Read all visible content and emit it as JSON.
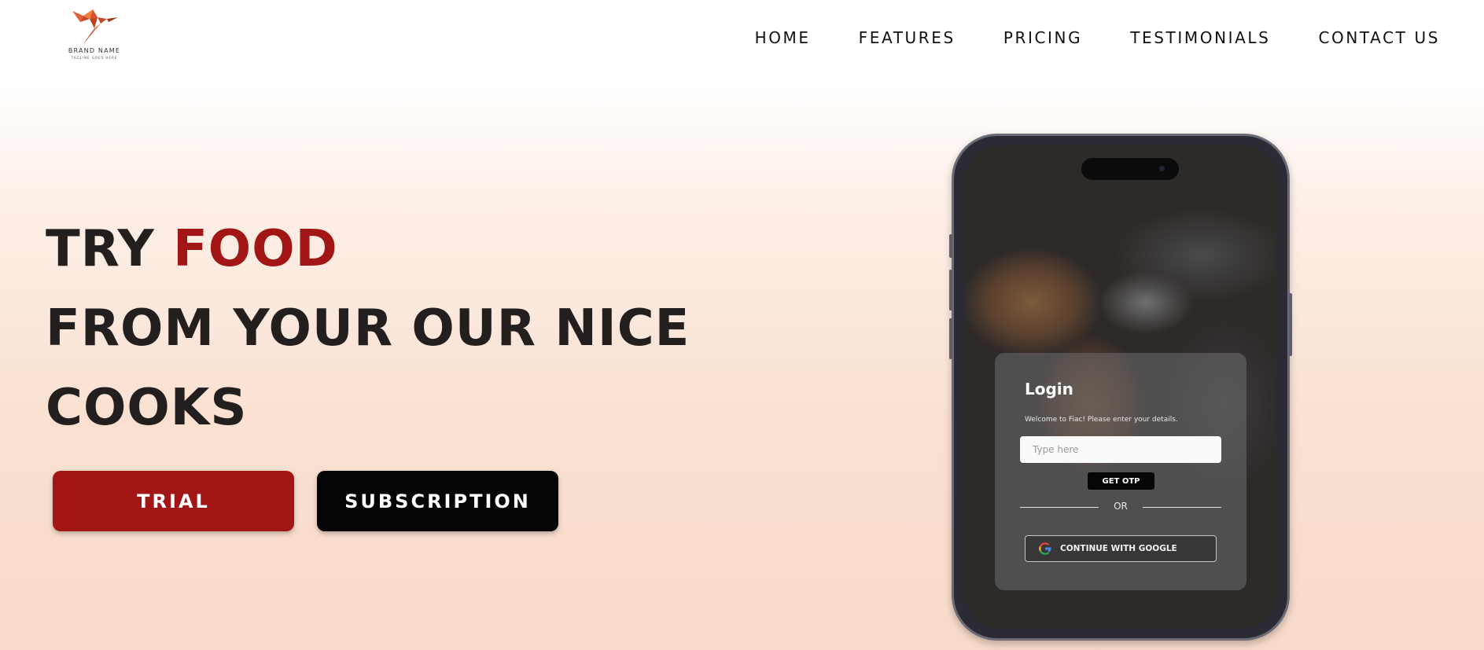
{
  "brand": {
    "name": "BRAND NAME",
    "tagline": "TAGLINE GOES HERE",
    "logo_icon": "hummingbird-icon"
  },
  "nav": {
    "items": [
      {
        "label": "HOME"
      },
      {
        "label": "FEATURES"
      },
      {
        "label": "PRICING"
      },
      {
        "label": "TESTIMONIALS"
      },
      {
        "label": "CONTACT US"
      }
    ]
  },
  "hero": {
    "line1_prefix": "TRY ",
    "line1_accent": "FOOD",
    "line2": "FROM YOUR OUR NICE",
    "line3": "COOKS",
    "trial_label": "TRIAL",
    "subscription_label": "SUBSCRIPTION"
  },
  "phone": {
    "login_title": "Login",
    "login_subtitle": "Welcome to Fiac! Please enter your details.",
    "input_placeholder": "Type here",
    "otp_label": "GET OTP",
    "or_label": "OR",
    "google_label": "CONTINUE WITH GOOGLE"
  },
  "colors": {
    "accent": "#a31616",
    "dark_button": "#050505",
    "text": "#231f1e"
  }
}
